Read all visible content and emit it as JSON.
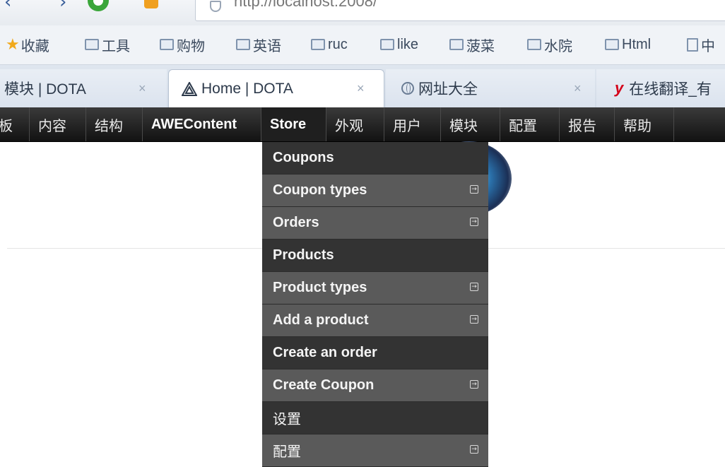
{
  "browser": {
    "address": "http://localhost:2008/",
    "bookmarks": [
      {
        "label": "收藏",
        "icon": "star-icon"
      },
      {
        "label": "工具",
        "icon": "folder-icon"
      },
      {
        "label": "购物",
        "icon": "folder-icon"
      },
      {
        "label": "英语",
        "icon": "folder-icon"
      },
      {
        "label": "ruc",
        "icon": "folder-icon"
      },
      {
        "label": "like",
        "icon": "folder-icon"
      },
      {
        "label": "菠菜",
        "icon": "folder-icon"
      },
      {
        "label": "水院",
        "icon": "folder-icon"
      },
      {
        "label": "Html",
        "icon": "folder-icon"
      },
      {
        "label": "中",
        "icon": "page-icon"
      }
    ],
    "tabs": [
      {
        "label": "模块 | DOTA",
        "close": "×"
      },
      {
        "label": "Home | DOTA",
        "close": "×"
      },
      {
        "label": "网址大全",
        "close": "×"
      },
      {
        "label": "在线翻译_有",
        "close": ""
      }
    ]
  },
  "admin_bar": {
    "items": [
      "板",
      "内容",
      "结构",
      "AWEContent",
      "Store",
      "外观",
      "用户",
      "模块",
      "配置",
      "报告",
      "帮助"
    ]
  },
  "store_menu": {
    "items": [
      {
        "label": "Coupons",
        "has_submenu": false
      },
      {
        "label": "Coupon types",
        "has_submenu": true
      },
      {
        "label": "Orders",
        "has_submenu": true
      },
      {
        "label": "Products",
        "has_submenu": false
      },
      {
        "label": "Product types",
        "has_submenu": true
      },
      {
        "label": "Add a product",
        "has_submenu": true
      },
      {
        "label": "Create an order",
        "has_submenu": false
      },
      {
        "label": "Create Coupon",
        "has_submenu": true
      },
      {
        "label": "设置",
        "has_submenu": false
      },
      {
        "label": "配置",
        "has_submenu": true
      }
    ]
  },
  "colors": {
    "admin_bar": "#1a1a1a",
    "menu_dark": "#333333",
    "menu_light": "#5a5a5a",
    "star": "#f1a91c"
  }
}
